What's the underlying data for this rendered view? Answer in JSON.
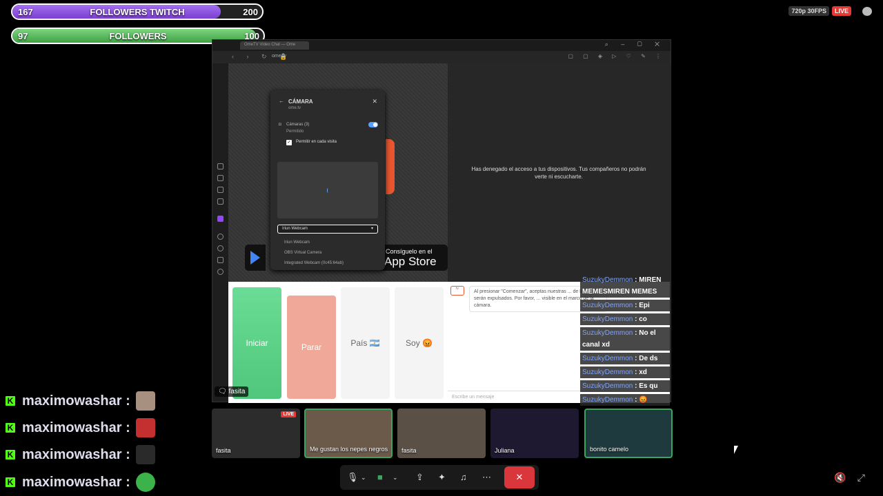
{
  "goals": [
    {
      "current": "167",
      "label": "FOLLOWERS TWITCH",
      "target": "200",
      "progress": 0.835,
      "color": "#8b4fd9"
    },
    {
      "current": "97",
      "label": "FOLLOWERS",
      "target": "100",
      "progress": 0.97,
      "color": "#4caf50"
    }
  ],
  "stream_status": {
    "resolution": "720p 30FPS",
    "live": "LIVE"
  },
  "browser": {
    "tab_title": "OmeTV Video Chat — Ome",
    "url": "ome.tv",
    "denied_message": "Has denegado el acceso a tus dispositivos. Tus compañeros no podrán verte ni escucharte.",
    "app_store_small": "Consíguelo en el",
    "app_store_big": "App Store",
    "partial_label": "lea"
  },
  "camera_popup": {
    "title": "CÁMARA",
    "site": "ome.tv",
    "cameras_label": "Cámaras (3)",
    "permission": "Permitido",
    "checkbox_label": "Permitir en cada visita",
    "selected": "Iriun Webcam",
    "options": [
      "Iriun Webcam",
      "OBS Virtual Camera",
      "Integrated Webcam (0c45:64ab)"
    ]
  },
  "ome": {
    "start": "Iniciar",
    "stop": "Parar",
    "country": "País 🇦🇷",
    "gender": "Soy 😡",
    "notice": "Al presionar \"Comenzar\", aceptas nuestras ... de las reglas serán expulsados. Por favor, ... visible en el marco de la cámara.",
    "input_placeholder": "Escribe un mensaje"
  },
  "screen_share_owner": "fasita",
  "twitch_chat": [
    {
      "user": "SuzukyDemmon",
      "text": ": MIREN MEMESMIREN MEMES"
    },
    {
      "user": "SuzukyDemmon",
      "text": ": Epi"
    },
    {
      "user": "SuzukyDemmon",
      "text": ": co"
    },
    {
      "user": "SuzukyDemmon",
      "text": ": No el canal xd"
    },
    {
      "user": "SuzukyDemmon",
      "text": ": De ds"
    },
    {
      "user": "SuzukyDemmon",
      "text": ": xd"
    },
    {
      "user": "SuzukyDemmon",
      "text": ": Es qu"
    },
    {
      "user": "SuzukyDemmon",
      "text": ": 😡"
    }
  ],
  "kick_chat": [
    {
      "user": "maximowashar :"
    },
    {
      "user": "maximowashar :"
    },
    {
      "user": "maximowashar :"
    },
    {
      "user": "maximowashar :"
    }
  ],
  "participants": [
    {
      "name": "fasita",
      "live": "LIVE",
      "bg": "#3a3a3a"
    },
    {
      "name": "Me gustan los nepes negros",
      "bg": "#6b5a4a"
    },
    {
      "name": "fasita",
      "bg": "#5a5046"
    },
    {
      "name": "Juliana",
      "bg": "#1e1830"
    },
    {
      "name": "bonito camelo",
      "bg": "#1e3a3e"
    }
  ],
  "colors": {
    "start_btn": "#5fd38a",
    "stop_btn": "#f0a898",
    "twitch_user": "#7fa4ff",
    "kick": "#53fc18",
    "hangup": "#da373c"
  }
}
